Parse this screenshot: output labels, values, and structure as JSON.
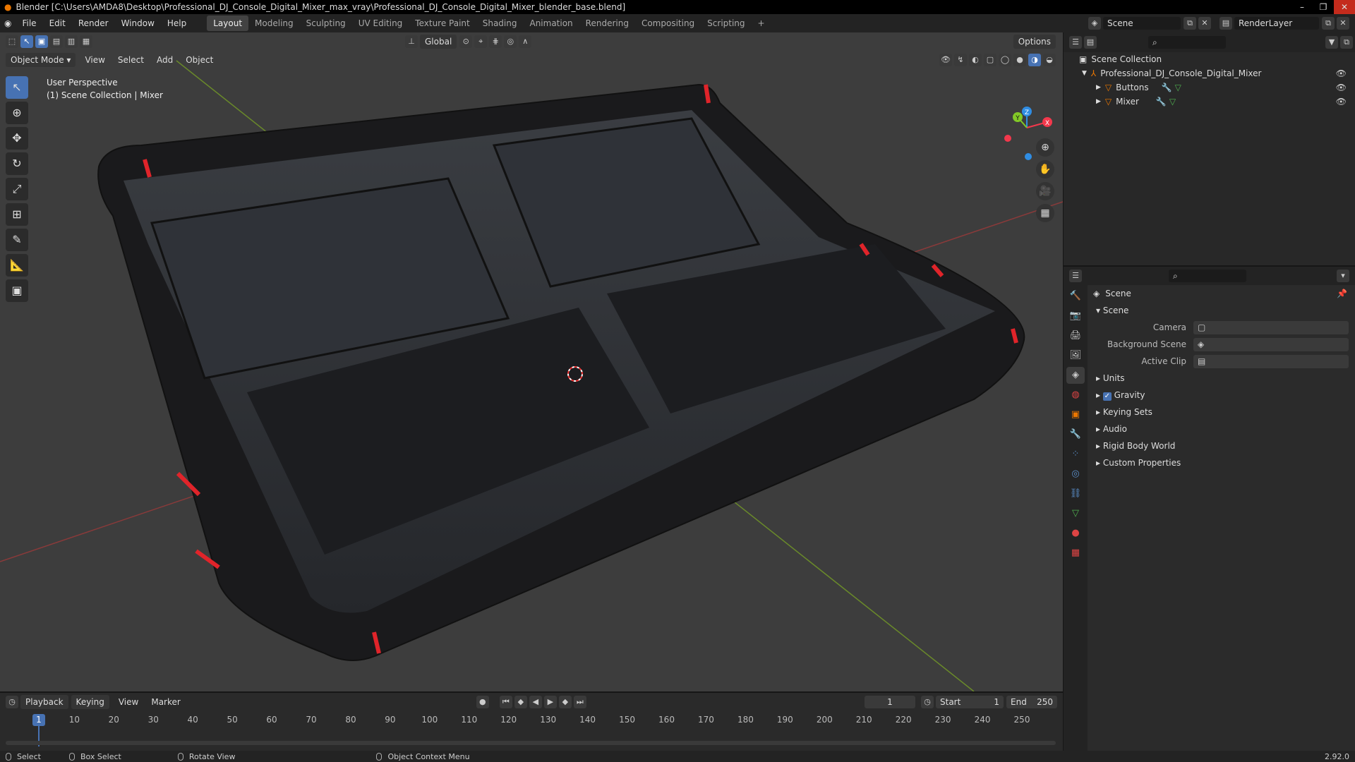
{
  "window": {
    "title": "Blender [C:\\Users\\AMDA8\\Desktop\\Professional_DJ_Console_Digital_Mixer_max_vray\\Professional_DJ_Console_Digital_Mixer_blender_base.blend]"
  },
  "menu": [
    "File",
    "Edit",
    "Render",
    "Window",
    "Help"
  ],
  "workspaces": [
    "Layout",
    "Modeling",
    "Sculpting",
    "UV Editing",
    "Texture Paint",
    "Shading",
    "Animation",
    "Rendering",
    "Compositing",
    "Scripting"
  ],
  "scene_field": "Scene",
  "renderlayer_field": "RenderLayer",
  "viewport": {
    "transform_orientation": "Global",
    "options_label": "Options",
    "mode": "Object Mode",
    "menus": [
      "View",
      "Select",
      "Add",
      "Object"
    ],
    "overlay_line1": "User Perspective",
    "overlay_line2": "(1) Scene Collection | Mixer",
    "gizmo": {
      "x": "X",
      "y": "Y",
      "z": "Z"
    }
  },
  "outliner": {
    "root": "Scene Collection",
    "items": [
      {
        "name": "Professional_DJ_Console_Digital_Mixer"
      },
      {
        "name": "Buttons"
      },
      {
        "name": "Mixer"
      }
    ]
  },
  "properties": {
    "header": "Scene",
    "panel_scene": "Scene",
    "camera_label": "Camera",
    "bg_scene_label": "Background Scene",
    "active_clip_label": "Active Clip",
    "panels": [
      "Units",
      "Gravity",
      "Keying Sets",
      "Audio",
      "Rigid Body World",
      "Custom Properties"
    ]
  },
  "timeline": {
    "menus": [
      "Playback",
      "Keying",
      "View",
      "Marker"
    ],
    "current_frame": "1",
    "start_label": "Start",
    "start_value": "1",
    "end_label": "End",
    "end_value": "250",
    "ticks": [
      "1",
      "10",
      "20",
      "30",
      "40",
      "50",
      "60",
      "70",
      "80",
      "90",
      "100",
      "110",
      "120",
      "130",
      "140",
      "150",
      "160",
      "170",
      "180",
      "190",
      "200",
      "210",
      "220",
      "230",
      "240",
      "250"
    ]
  },
  "status": {
    "select": "Select",
    "box_select": "Box Select",
    "rotate_view": "Rotate View",
    "context_menu": "Object Context Menu",
    "version": "2.92.0"
  },
  "colors": {
    "accent": "#4772b3",
    "axis_x": "#f3384c",
    "axis_y": "#82c927",
    "axis_z": "#2f8de3"
  }
}
